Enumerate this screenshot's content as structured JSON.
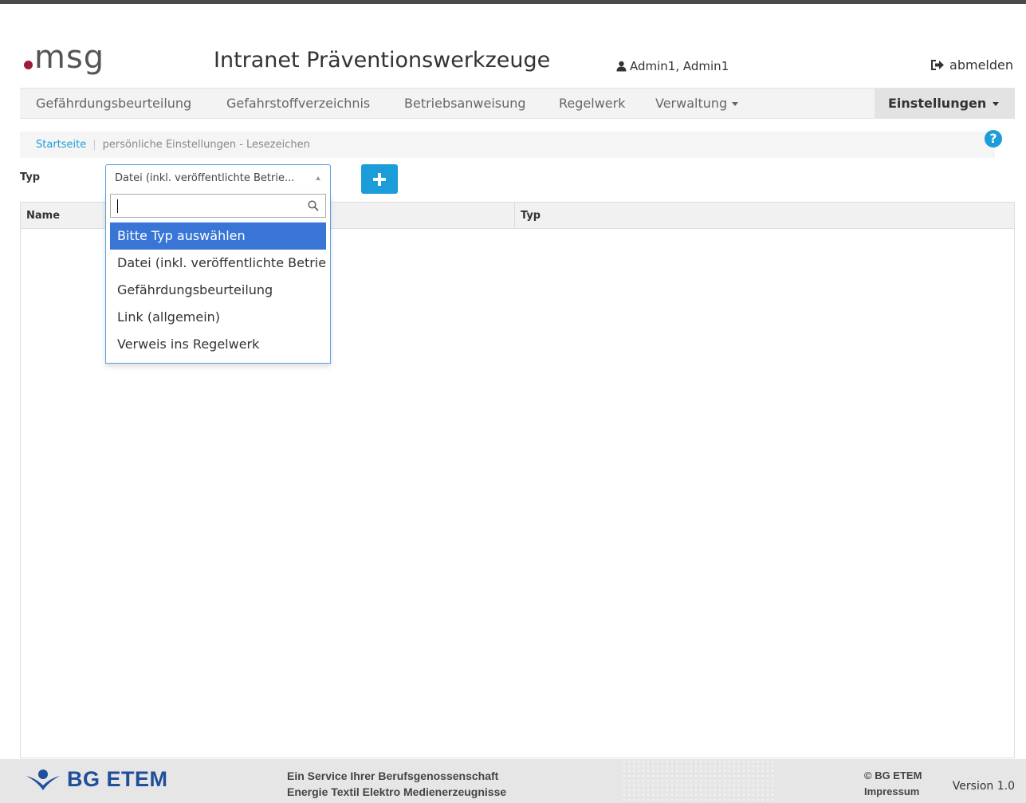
{
  "header": {
    "logo_text": "msg",
    "app_title": "Intranet Präventionswerkzeuge",
    "user_name": "Admin1, Admin1",
    "logout_label": "abmelden"
  },
  "nav": {
    "items": [
      {
        "label": "Gefährdungsbeurteilung"
      },
      {
        "label": "Gefahrstoffverzeichnis"
      },
      {
        "label": "Betriebsanweisung"
      },
      {
        "label": "Regelwerk"
      },
      {
        "label": "Verwaltung"
      }
    ],
    "settings_label": "Einstellungen"
  },
  "breadcrumb": {
    "home": "Startseite",
    "separator": "|",
    "current": "persönliche Einstellungen - Lesezeichen"
  },
  "help_label": "?",
  "filter": {
    "label": "Typ",
    "selected": "Datei (inkl. veröffentlichte Betrie...",
    "search_value": "",
    "options": [
      {
        "label": "Bitte Typ auswählen",
        "active": true
      },
      {
        "label": "Datei (inkl. veröffentlichte Betrie",
        "active": false
      },
      {
        "label": "Gefährdungsbeurteilung",
        "active": false
      },
      {
        "label": "Link (allgemein)",
        "active": false
      },
      {
        "label": "Verweis ins Regelwerk",
        "active": false
      }
    ]
  },
  "table": {
    "columns": [
      "Name",
      "Typ"
    ],
    "rows": []
  },
  "footer": {
    "brand": "BG ETEM",
    "service_line1": "Ein Service Ihrer Berufsgenossenschaft",
    "service_line2": "Energie Textil Elektro Medienerzeugnisse",
    "copyright": "© BG ETEM",
    "impressum": "Impressum",
    "version": "Version 1.0"
  },
  "colors": {
    "accent": "#1a9dd9",
    "logo_dot": "#9c1d3b",
    "dropdown_highlight": "#3875d7",
    "footer_brand": "#1f4e9a"
  }
}
